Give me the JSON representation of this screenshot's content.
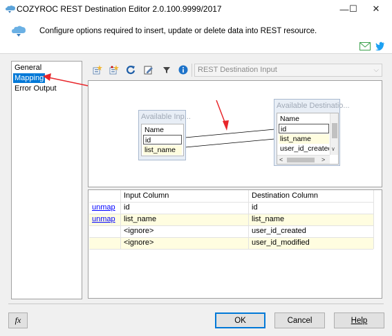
{
  "window": {
    "title": "COZYROC REST Destination Editor 2.0.100.9999/2017",
    "controls": {
      "minimize": "—",
      "maximize": "☐",
      "close": "✕"
    }
  },
  "header": {
    "description": "Configure options required to insert, update or delete data into REST resource."
  },
  "nav": {
    "items": [
      {
        "label": "General",
        "selected": false
      },
      {
        "label": "Mapping",
        "selected": true
      },
      {
        "label": "Error Output",
        "selected": false
      }
    ]
  },
  "toolbar": {
    "destination_select": "REST Destination Input"
  },
  "diagram": {
    "input_box": {
      "title": "Available Inp...",
      "items": [
        "Name",
        "id",
        "list_name"
      ]
    },
    "destination_box": {
      "title": "Available Destinatio...",
      "items": [
        "Name",
        "id",
        "list_name",
        "user_id_created"
      ]
    }
  },
  "grid": {
    "headers": [
      "",
      "Input Column",
      "Destination Column"
    ],
    "rows": [
      {
        "action": "unmap",
        "input": "id",
        "destination": "id"
      },
      {
        "action": "unmap",
        "input": "list_name",
        "destination": "list_name"
      },
      {
        "action": "",
        "input": "<ignore>",
        "destination": "user_id_created"
      },
      {
        "action": "",
        "input": "<ignore>",
        "destination": "user_id_modified"
      }
    ]
  },
  "footer": {
    "fx_label": "fx",
    "ok_label": "OK",
    "cancel_label": "Cancel",
    "help_label": "Help"
  },
  "colors": {
    "accent": "#0078d7",
    "annotation_red": "#e8262b",
    "highlight_row": "#fffde0"
  }
}
